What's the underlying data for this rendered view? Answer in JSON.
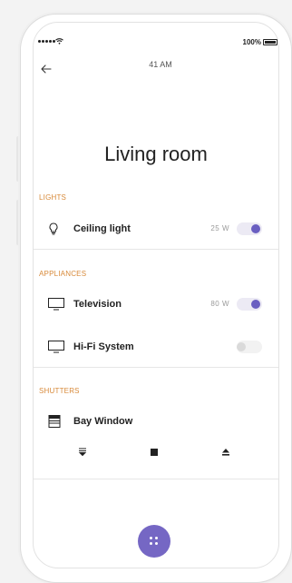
{
  "status_bar": {
    "battery_label": "100%"
  },
  "header": {
    "time": "41 AM",
    "back_icon": "arrow-left-icon"
  },
  "page_title": "Living room",
  "sections": {
    "lights": {
      "label": "LIGHTS",
      "items": [
        {
          "name": "Ceiling light",
          "watts": "25 W",
          "on": true,
          "icon": "lightbulb-icon"
        }
      ]
    },
    "appliances": {
      "label": "APPLIANCES",
      "items": [
        {
          "name": "Television",
          "watts": "80 W",
          "on": true,
          "icon": "monitor-icon"
        },
        {
          "name": "Hi-Fi System",
          "watts": "",
          "on": false,
          "icon": "monitor-icon"
        }
      ]
    },
    "shutters": {
      "label": "SHUTTERS",
      "items": [
        {
          "name": "Bay Window",
          "icon": "shutter-icon"
        }
      ],
      "controls": {
        "down_icon": "shutter-down-icon",
        "stop_icon": "stop-icon",
        "up_icon": "eject-up-icon"
      }
    }
  },
  "fab": {
    "icon": "grid-dots-icon"
  },
  "colors": {
    "accent": "#6a5fc1",
    "fab": "#7567c4",
    "section_label": "#d88a3a"
  }
}
